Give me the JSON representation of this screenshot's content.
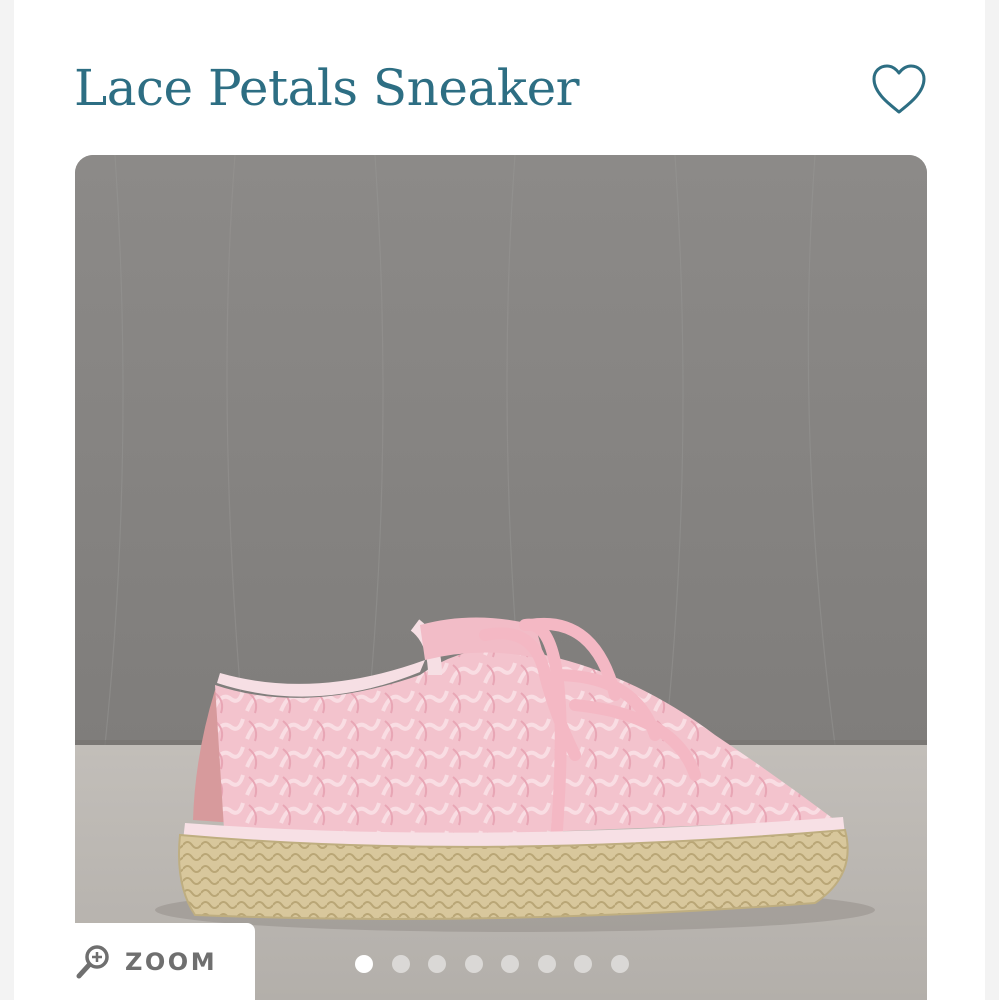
{
  "product": {
    "title": "Lace Petals Sneaker"
  },
  "favorite": {
    "icon": "heart-outline-icon",
    "color": "#2d6e83"
  },
  "gallery": {
    "image_subject": "pink lace espadrille sneaker on grey backdrop",
    "zoom_label": "ZOOM",
    "zoom_icon": "magnifier-plus-icon",
    "slides": 8,
    "active_slide": 1
  },
  "colors": {
    "title": "#2d6e83",
    "backdrop": "#8f8d8b",
    "floor": "#b9b5b0",
    "shoe_pink": "#f2b8c4",
    "jute": "#d9c89e"
  }
}
